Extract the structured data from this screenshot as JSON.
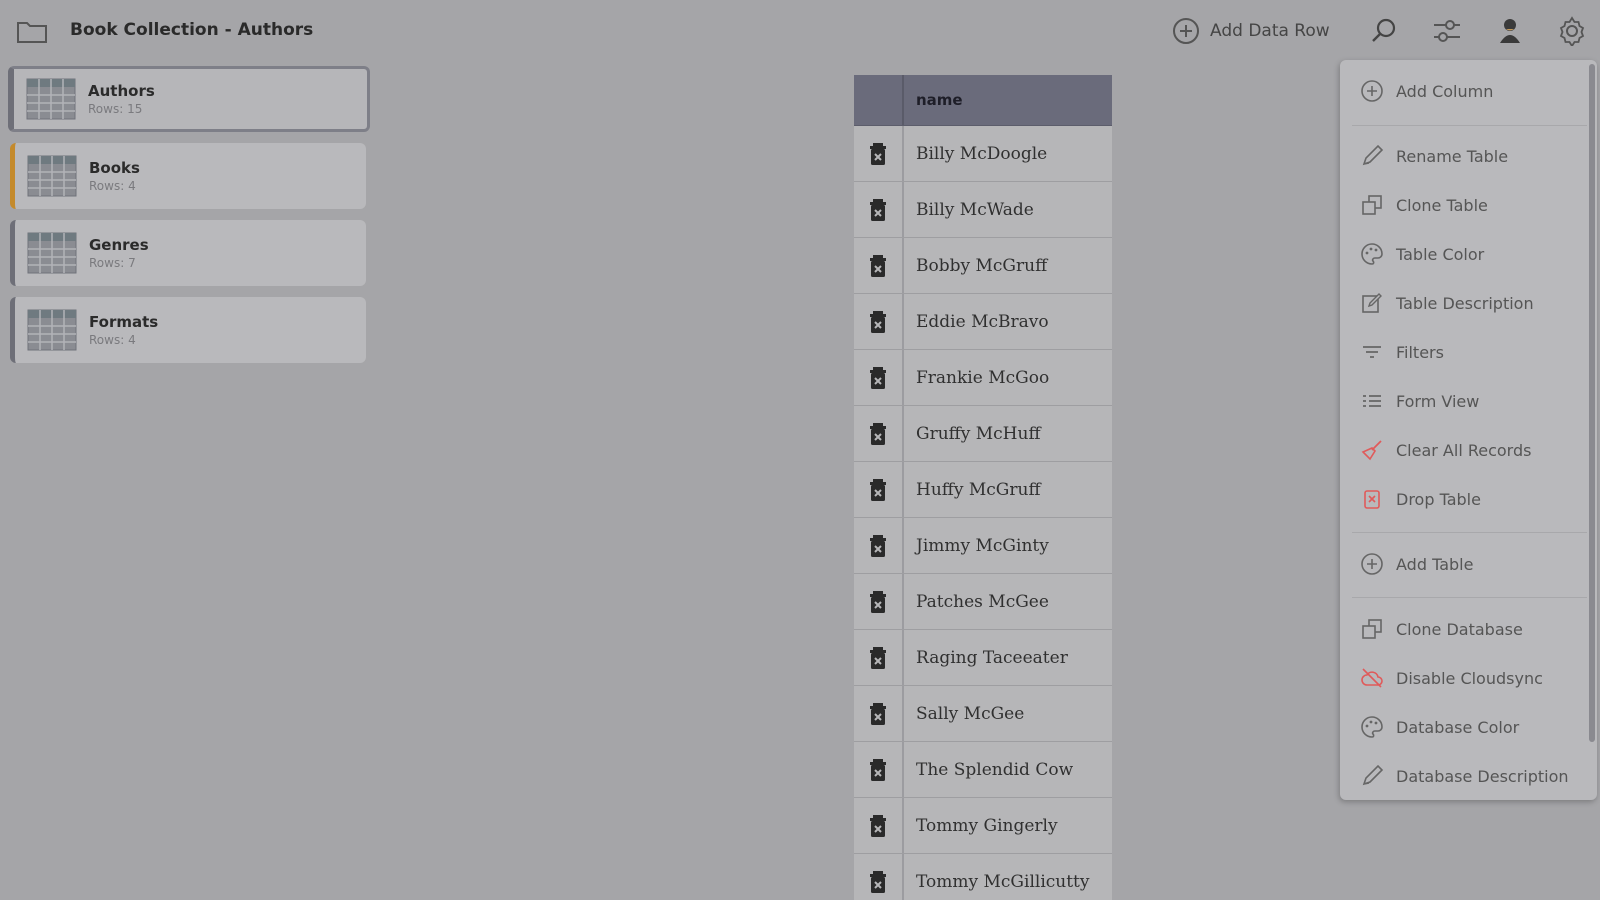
{
  "header": {
    "title": "Book Collection - Authors",
    "add_row_label": "Add Data Row"
  },
  "sidebar": {
    "tables": [
      {
        "name": "Authors",
        "rows": "Rows: 15"
      },
      {
        "name": "Books",
        "rows": "Rows: 4"
      },
      {
        "name": "Genres",
        "rows": "Rows: 7"
      },
      {
        "name": "Formats",
        "rows": "Rows: 4"
      }
    ]
  },
  "datatable": {
    "column": "name",
    "rows": [
      "Billy McDoogle",
      "Billy McWade",
      "Bobby McGruff",
      "Eddie McBravo",
      "Frankie McGoo",
      "Gruffy McHuff",
      "Huffy McGruff",
      "Jimmy McGinty",
      "Patches McGee",
      "Raging Taceeater",
      "Sally McGee",
      "The Splendid Cow",
      "Tommy Gingerly",
      "Tommy McGillicutty"
    ]
  },
  "menu": {
    "items": [
      "Add Column",
      "Rename Table",
      "Clone Table",
      "Table Color",
      "Table Description",
      "Filters",
      "Form View",
      "Clear All Records",
      "Drop Table",
      "Add Table",
      "Clone Database",
      "Disable Cloudsync",
      "Database Color",
      "Database Description"
    ]
  },
  "colors": {
    "danger": "#e05a5a",
    "header_bg": "#6a6b7b",
    "accent_orange": "#c48a2c"
  }
}
